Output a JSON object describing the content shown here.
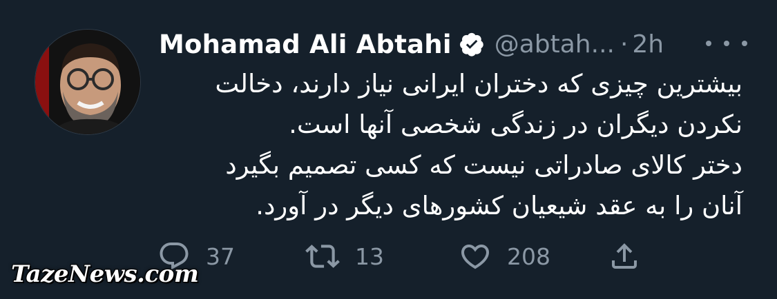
{
  "tweet": {
    "author_name": "Mohamad Ali Abtahi",
    "handle": "@abtah...",
    "separator": "·",
    "time": "2h",
    "body_lines": [
      "بیشترین چیزی که دختران ایرانی نیاز دارند، دخالت",
      "نکردن دیگران در زندگی شخصی آنها است.",
      "دختر کالای صادراتی نیست که کسی تصمیم بگیرد",
      "آنان را به عقد شیعیان کشورهای دیگر در آورد."
    ]
  },
  "actions": {
    "reply_count": "37",
    "retweet_count": "13",
    "like_count": "208"
  },
  "watermark": "TazeNews.com",
  "icons": {
    "verified": "verified-badge-icon",
    "more": "more-horizontal-icon",
    "reply": "reply-icon",
    "retweet": "retweet-icon",
    "like": "heart-icon",
    "share": "share-icon"
  },
  "colors": {
    "background": "#15202b",
    "text": "#ffffff",
    "secondary": "#8b98a5"
  }
}
